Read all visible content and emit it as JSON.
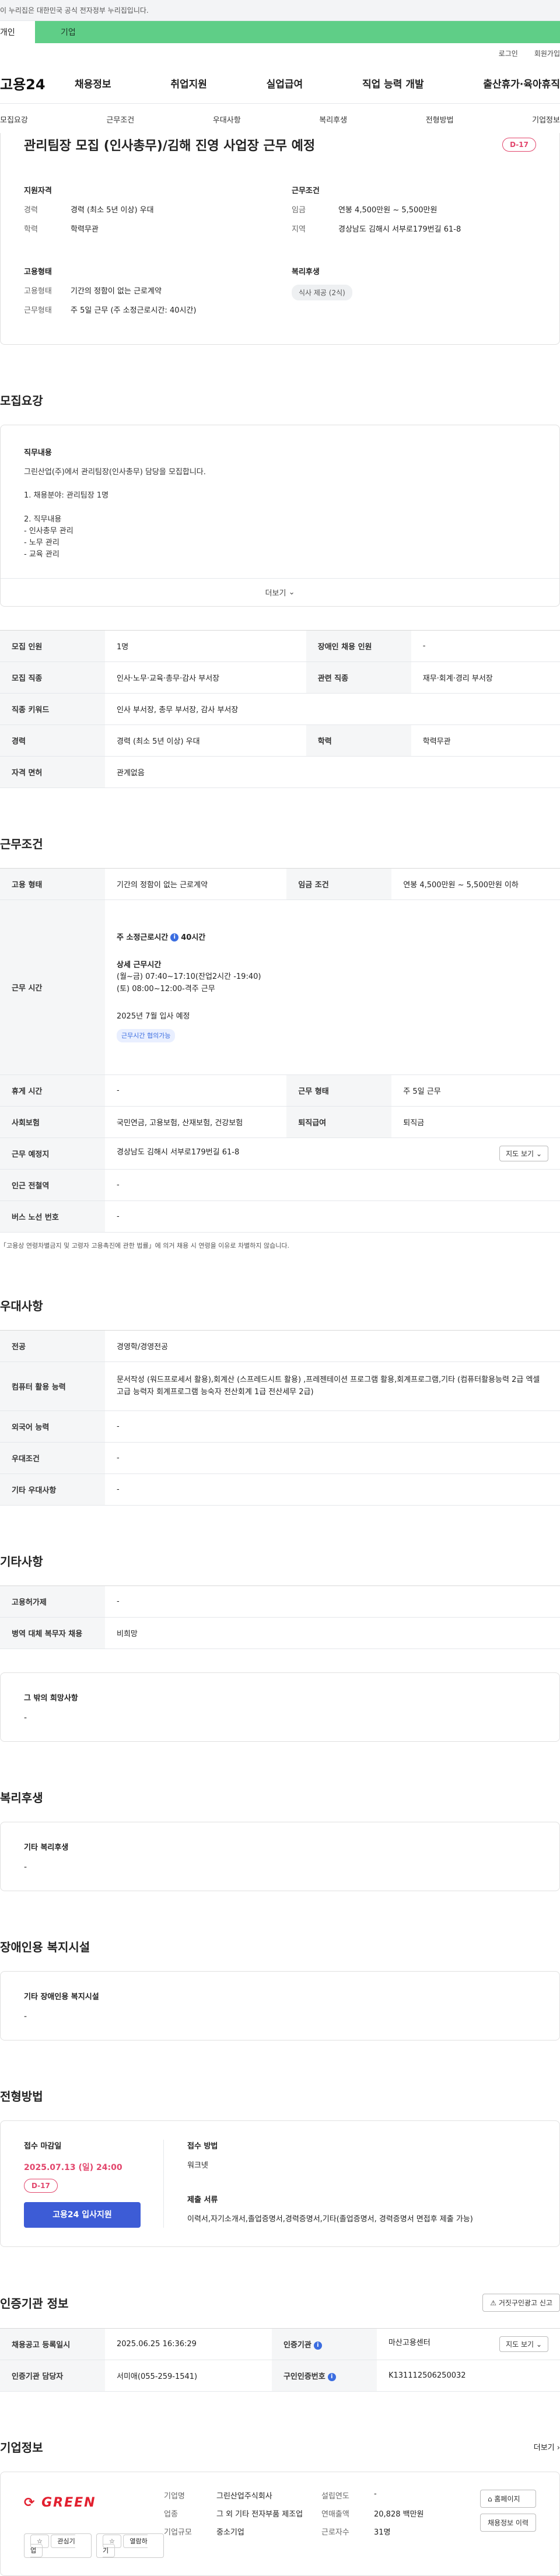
{
  "banner": {
    "text": "이 누리집은 대한민국 공식 전자정부 누리집입니다."
  },
  "tabs": {
    "left": "개인",
    "right": "기업"
  },
  "util": {
    "login": "로그인",
    "signup": "회원가입"
  },
  "gnb": {
    "logo": "고용24",
    "items": [
      "채용정보",
      "취업지원",
      "실업급여",
      "직업 능력 개발",
      "출산휴가·육아휴직"
    ]
  },
  "subnav": {
    "items": [
      "모집요강",
      "근무조건",
      "우대사항",
      "복리후생",
      "전형방법",
      "기업정보"
    ]
  },
  "summary": {
    "title": "관리팀장 모집 (인사총무)/김해 진영 사업장 근무 예정",
    "dday": "D-17",
    "qual_title": "지원자격",
    "career_k": "경력",
    "career_v": "경력 (최소 5년 이상) 우대",
    "edu_k": "학력",
    "edu_v": "학력무관",
    "cond_title": "근무조건",
    "wage_k": "임금",
    "wage_v": "연봉 4,500만원 ~ 5,500만원",
    "region_k": "지역",
    "region_v": "경상남도 김해시 서부로179번길 61-8",
    "emp_title": "고용형태",
    "type_k": "고용형태",
    "type_v": "기간의 정함이 없는 근로계약",
    "work_k": "근무형태",
    "work_v": "주 5일 근무 (주 소정근로시간: 40시간)",
    "welfare_title": "복리후생",
    "welfare_pill": "식사 제공 (2식)"
  },
  "recruit": {
    "section": "모집요강",
    "desc_title": "직무내용",
    "desc_lines": [
      "그린산업(주)에서 관리팀장(인사총무) 담당을 모집합니다.",
      "",
      "1. 채용분야: 관리팀장 1명",
      "",
      "2. 직무내용",
      "- 인사총무 관리",
      "- 노무 관리",
      "- 교육 관리"
    ],
    "more": "더보기",
    "rows": [
      {
        "k1": "모집 인원",
        "v1": "1명",
        "k2": "장애인 채용 인원",
        "v2": "-"
      },
      {
        "k1": "모집 직종",
        "v1": "인사·노무·교육·총무·감사 부서장",
        "k2": "관련 직종",
        "v2": "재무·회계·경리 부서장"
      },
      {
        "k1": "직종 키워드",
        "v1": "인사 부서장, 총무 부서장, 감사 부서장",
        "k2": "",
        "v2": ""
      },
      {
        "k1": "경력",
        "v1": "경력 (최소 5년 이상) 우대",
        "k2": "학력",
        "v2": "학력무관"
      },
      {
        "k1": "자격 면허",
        "v1": "관계없음",
        "k2": "",
        "v2": ""
      }
    ]
  },
  "conditions": {
    "section": "근무조건",
    "type_k": "고용 형태",
    "type_v": "기간의 정함이 없는 근로계약",
    "wage_k": "임금 조건",
    "wage_v": "연봉 4,500만원 ~ 5,500만원 이하",
    "hours_k": "근무 시간",
    "hours_title": "주 소정근로시간",
    "hours_value": "40시간",
    "detail_title": "상세 근무시간",
    "detail_1": "(월~금) 07:40~17:10(잔업2시간 -19:40)",
    "detail_2": "(토) 08:00~12:00-격주 근무",
    "start": "2025년 7월 입사 예정",
    "tag": "근무시간 협의가능",
    "break_k": "휴게 시간",
    "break_v": "-",
    "form_k": "근무 형태",
    "form_v": "주 5일 근무",
    "ins_k": "사회보험",
    "ins_v": "국민연금, 고용보험, 산재보험, 건강보험",
    "sev_k": "퇴직급여",
    "sev_v": "퇴직금",
    "place_k": "근무 예정지",
    "place_v": "경상남도 김해시 서부로179번길 61-8",
    "map_btn": "지도 보기",
    "subway_k": "인근 전철역",
    "subway_v": "-",
    "bus_k": "버스 노선 번호",
    "bus_v": "-",
    "note": "「고용상 연령차별금지 및 고령자 고용촉진에 관한 법률」에 의거 채용 시 연령을 이유로 차별하지 않습니다."
  },
  "prefer": {
    "section": "우대사항",
    "major_k": "전공",
    "major_v": "경영학/경영전공",
    "pc_k": "컴퓨터 활용 능력",
    "pc_v": "문서작성 (워드프로세서 활용),회계산 (스프레드시트 활용) ,프레젠테이션 프로그램 활용,회계프로그램,기타 (컴퓨터활용능력 2급 엑셀 고급 능력자 회계프로그램 능숙자 전산회계 1급 전산세무 2급)",
    "lang_k": "외국어 능력",
    "lang_v": "-",
    "cond_k": "우대조건",
    "cond_v": "-",
    "etc_k": "기타 우대사항",
    "etc_v": "-"
  },
  "etc": {
    "section": "기타사항",
    "r1_k": "고용허가제",
    "r1_v": "-",
    "r2_k": "병역 대체 복무자 채용",
    "r2_v": "비희망",
    "wish_title": "그 밖의 희망사항",
    "wish_v": "-"
  },
  "welfare": {
    "section": "복리후생",
    "title": "기타 복리후생",
    "value": "-"
  },
  "disabled": {
    "section": "장애인용 복지시설",
    "title": "기타 장애인용 복지시설",
    "value": "-"
  },
  "selection": {
    "section": "전형방법",
    "deadline_title": "접수 마감일",
    "deadline": "2025.07.13 (일) 24:00",
    "dday": "D-17",
    "apply_btn": "고용24 입사지원",
    "method_title": "접수 방법",
    "method_v": "워크넷",
    "docs_title": "제출 서류",
    "docs_v": "이력서,자기소개서,졸업증명서,경력증명서,기타(졸업증명서, 경력증명서 면접후 제출 가능)"
  },
  "agency": {
    "section": "인증기관 정보",
    "report_btn": "거짓구인광고 신고",
    "reg_k": "채용공고 등록일시",
    "reg_v": "2025.06.25 16:36:29",
    "org_k": "인증기관",
    "org_v": "마산고용센터",
    "map_btn": "지도 보기",
    "mgr_k": "인증기관 담당자",
    "mgr_v": "서미애(055-259-1541)",
    "id_k": "구인인증번호",
    "id_v": "K131112506250032"
  },
  "company": {
    "section": "기업정보",
    "more": "더보기",
    "logo": "GREEN",
    "fav": "관심기업",
    "bookmark": "열람하기",
    "name_k": "기업명",
    "name_v": "그린산업주식회사",
    "biz_k": "업종",
    "biz_v": "그 외 기타 전자부품 제조업",
    "size_k": "기업규모",
    "size_v": "중소기업",
    "est_k": "설립연도",
    "est_v": "-",
    "sales_k": "연매출액",
    "sales_v": "20,828 백만원",
    "emp_k": "근로자수",
    "emp_v": "31명",
    "homepage": "홈페이지",
    "jobs": "채용정보 이력"
  },
  "colors": {
    "accent": "#3d5cd6",
    "dday": "#e2466c",
    "tab_green": "#5fce87"
  }
}
